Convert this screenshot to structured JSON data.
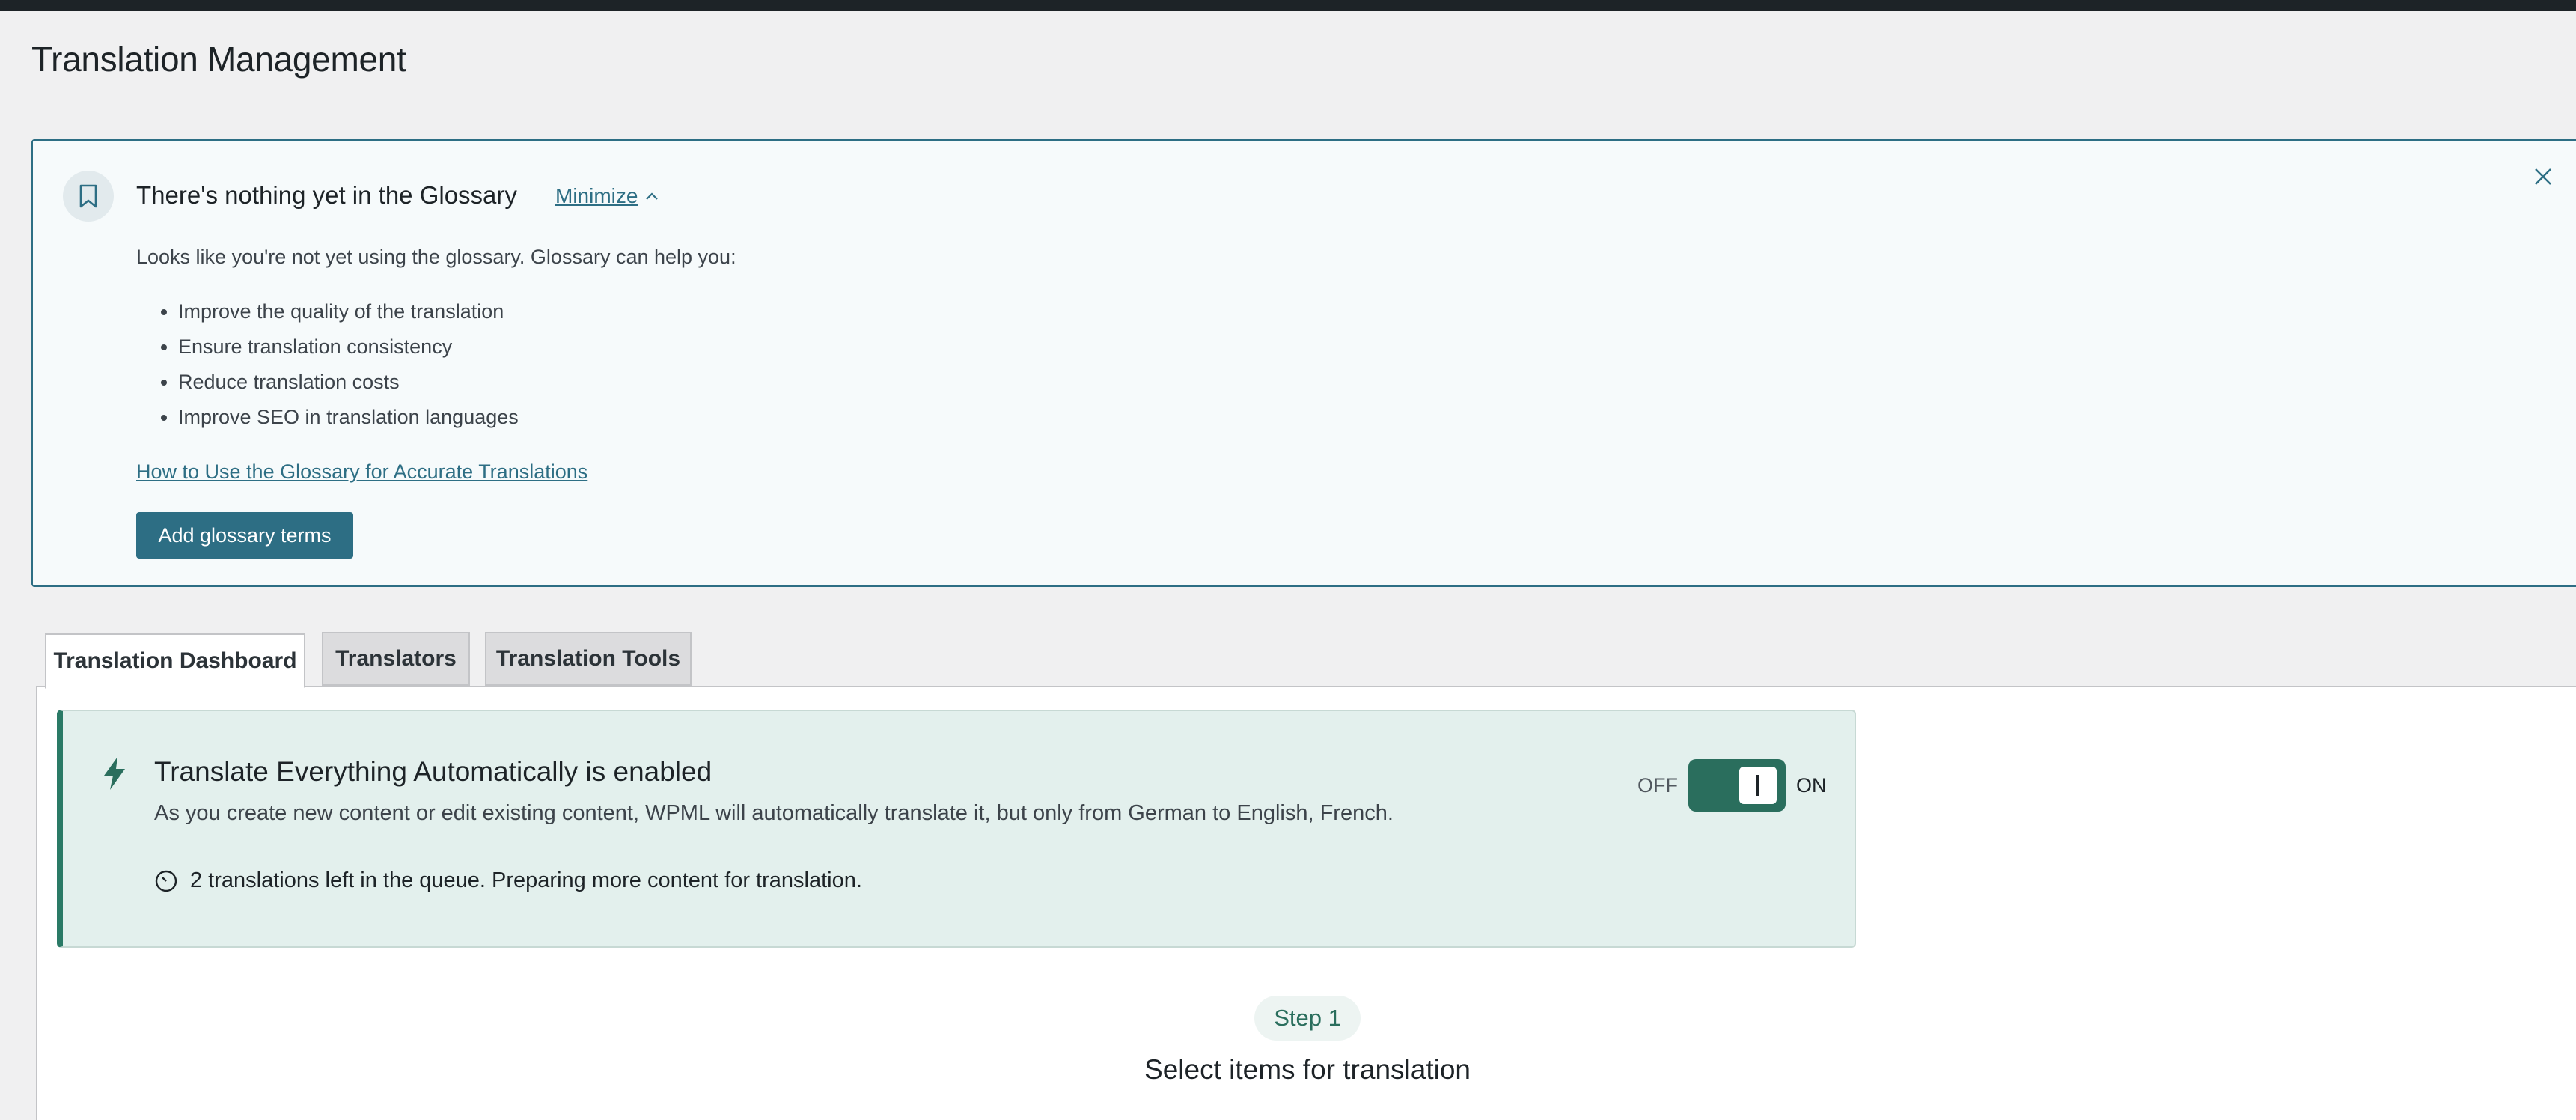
{
  "page": {
    "title": "Translation Management"
  },
  "glossary_notice": {
    "icon": "bookmark-icon",
    "title": "There's nothing yet in the Glossary",
    "minimize_label": "Minimize",
    "intro": "Looks like you're not yet using the glossary. Glossary can help you:",
    "benefits": [
      "Improve the quality of the translation",
      "Ensure translation consistency",
      "Reduce translation costs",
      "Improve SEO in translation languages"
    ],
    "guide_link": "How to Use the Glossary for Accurate Translations",
    "add_button": "Add glossary terms"
  },
  "tabs": [
    {
      "label": "Translation Dashboard",
      "active": true
    },
    {
      "label": "Translators",
      "active": false
    },
    {
      "label": "Translation Tools",
      "active": false
    }
  ],
  "auto_translate": {
    "title": "Translate Everything Automatically is enabled",
    "description": "As you create new content or edit existing content, WPML will automatically translate it, but only from German to English, French.",
    "queue_status": "2 translations left in the queue. Preparing more content for translation.",
    "toggle_off_label": "OFF",
    "toggle_on_label": "ON",
    "enabled": true
  },
  "step": {
    "badge": "Step 1",
    "title": "Select items for translation"
  },
  "colors": {
    "accent": "#2d6e84",
    "toggle_green": "#2a6e5d",
    "card_bg": "#e3f0ed"
  }
}
